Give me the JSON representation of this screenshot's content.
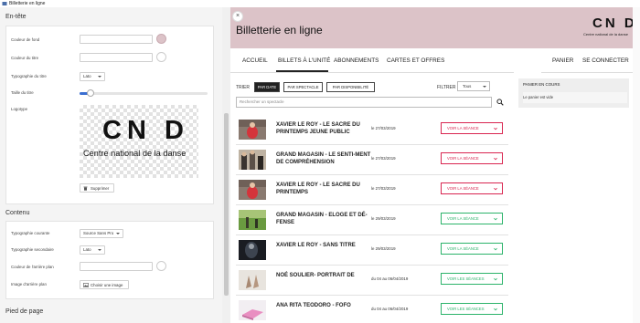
{
  "window": {
    "title": "Billetterie en ligne",
    "icon": "app-icon"
  },
  "editor": {
    "header_section": {
      "title": "En-tête",
      "bg_color_label": "Couleur de fond",
      "title_color_label": "Couleur du titre",
      "title_font_label": "Typographie du titre",
      "title_font_value": "Lato",
      "title_size_label": "Taille du titre",
      "title_size_value": 0.1,
      "logo_label": "Logotype",
      "logo_big": "CN D",
      "logo_small": "Centre national de la danse",
      "delete_label": "Supprimer",
      "bg_swatch_color": "#dcc3c8"
    },
    "content_section": {
      "title": "Contenu",
      "current_font_label": "Typographie courante",
      "current_font_value": "Source Sans Pro",
      "secondary_font_label": "Typographie secondaire",
      "secondary_font_value": "Lato",
      "bg_image_color_label": "Couleur de l'arrière plan",
      "bg_image_label": "Image d'arrière plan",
      "choose_image_label": "Choisir une image"
    },
    "footer_section": {
      "title": "Pied de page"
    }
  },
  "preview": {
    "close_label": "×",
    "site_title": "Billetterie en ligne",
    "logo_big": "CN D",
    "logo_small": "Centre national de la danse",
    "nav": {
      "accueil": "ACCUEIL",
      "billets": "BILLETS À L'UNITÉ",
      "abonnements": "ABONNEMENTS",
      "cartes": "CARTES ET OFFRES",
      "panier": "PANIER",
      "connect": "SE CONNECTER"
    },
    "sort": {
      "label": "TRIER",
      "by_date": "PAR DATE",
      "by_show": "PAR SPECTACLE",
      "by_avail": "PAR DISPONIBILITÉ"
    },
    "filter": {
      "label": "FILTRER",
      "value": "Tous"
    },
    "search_placeholder": "Rechercher un spectacle",
    "cart": {
      "title": "PANIER EN COURS",
      "empty": "Le panier est vide"
    },
    "events": [
      {
        "title": "XAVIER LE ROY - LE SACRE DU PRINTEMPS JEUNE PUBLIC",
        "date": "le 27/03/2019",
        "button": "VOIR LA SÉANCE",
        "style": "red",
        "thumb": "red-figure"
      },
      {
        "title": "GRAND MAGASIN - LE SENTI-MENT DE COMPRÉHENSION",
        "date": "le 27/03/2019",
        "button": "VOIR LA SÉANCE",
        "style": "red",
        "thumb": "people"
      },
      {
        "title": "XAVIER LE ROY - LE SACRE DU PRINTEMPS",
        "date": "le 27/03/2019",
        "button": "VOIR LA SÉANCE",
        "style": "red",
        "thumb": "red-figure"
      },
      {
        "title": "GRAND MAGASIN - ELOGE ET DÉ-FENSE",
        "date": "le 29/03/2019",
        "button": "VOIR LA SÉANCE",
        "style": "green",
        "thumb": "green"
      },
      {
        "title": "XAVIER LE ROY - SANS TITRE",
        "date": "le 29/03/2019",
        "button": "VOIR LA SÉANCE",
        "style": "green",
        "thumb": "dark"
      },
      {
        "title": "NOÉ SOULIER- PORTRAIT DE",
        "date": "du 04 au 06/04/2019",
        "button": "VOIR LES SÉANCES",
        "style": "green",
        "thumb": "hands"
      },
      {
        "title": "ANA RITA TEODORO - FOFO",
        "date": "du 04 au 06/04/2019",
        "button": "VOIR LES SÉANCES",
        "style": "green",
        "thumb": "pink"
      }
    ]
  }
}
